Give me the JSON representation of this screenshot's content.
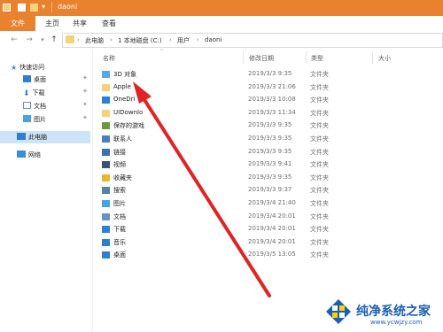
{
  "window": {
    "title": "daoni"
  },
  "ribbon": {
    "tabs": [
      "文件",
      "主页",
      "共享",
      "查看"
    ]
  },
  "address": {
    "crumbs": [
      "此电脑",
      "1 本地磁盘 (C:)",
      "用户",
      "daoni"
    ]
  },
  "sidebar": {
    "items": [
      {
        "label": "快速访问",
        "icon": "star-icon"
      },
      {
        "label": "桌面",
        "icon": "desktop-icon",
        "pinned": true
      },
      {
        "label": "下载",
        "icon": "download-icon",
        "pinned": true
      },
      {
        "label": "文档",
        "icon": "document-icon",
        "pinned": true
      },
      {
        "label": "图片",
        "icon": "picture-icon",
        "pinned": true
      },
      {
        "label": "此电脑",
        "icon": "computer-icon",
        "selected": true
      },
      {
        "label": "网络",
        "icon": "network-icon"
      }
    ]
  },
  "columns": {
    "name": "名称",
    "date": "修改日期",
    "type": "类型",
    "size": "大小"
  },
  "files": [
    {
      "name": "3D 对象",
      "date": "2019/3/3 9:35",
      "type": "文件夹",
      "icon": "3d-objects-icon"
    },
    {
      "name": "Apple",
      "date": "2019/3/3 21:06",
      "type": "文件夹",
      "icon": "folder-icon"
    },
    {
      "name": "OneDri",
      "date": "2019/3/3 10:08",
      "type": "文件夹",
      "icon": "onedrive-icon"
    },
    {
      "name": "UIDownlo",
      "date": "2019/3/3 11:34",
      "type": "文件夹",
      "icon": "folder-icon"
    },
    {
      "name": "保存的游戏",
      "date": "2019/3/3 9:35",
      "type": "文件夹",
      "icon": "saved-games-icon"
    },
    {
      "name": "联系人",
      "date": "2019/3/3 9:35",
      "type": "文件夹",
      "icon": "contacts-icon"
    },
    {
      "name": "链接",
      "date": "2019/3/3 9:35",
      "type": "文件夹",
      "icon": "links-icon"
    },
    {
      "name": "视频",
      "date": "2019/3/3 9:41",
      "type": "文件夹",
      "icon": "videos-icon"
    },
    {
      "name": "收藏夹",
      "date": "2019/3/3 9:35",
      "type": "文件夹",
      "icon": "favorites-icon"
    },
    {
      "name": "搜索",
      "date": "2019/3/3 9:37",
      "type": "文件夹",
      "icon": "search-icon"
    },
    {
      "name": "图片",
      "date": "2019/3/4 21:40",
      "type": "文件夹",
      "icon": "pictures-icon"
    },
    {
      "name": "文档",
      "date": "2019/3/4 20:01",
      "type": "文件夹",
      "icon": "documents-icon"
    },
    {
      "name": "下载",
      "date": "2019/3/4 20:01",
      "type": "文件夹",
      "icon": "downloads-icon"
    },
    {
      "name": "音乐",
      "date": "2019/3/4 20:01",
      "type": "文件夹",
      "icon": "music-icon"
    },
    {
      "name": "桌面",
      "date": "2019/3/5 13:05",
      "type": "文件夹",
      "icon": "desktop-folder-icon"
    }
  ],
  "watermark": {
    "text": "纯净系统之家",
    "url": "www.ycwjzy.com"
  },
  "colors": {
    "titlebar": "#e8822e",
    "selection": "#cce4f7",
    "arrow": "#e02424"
  }
}
